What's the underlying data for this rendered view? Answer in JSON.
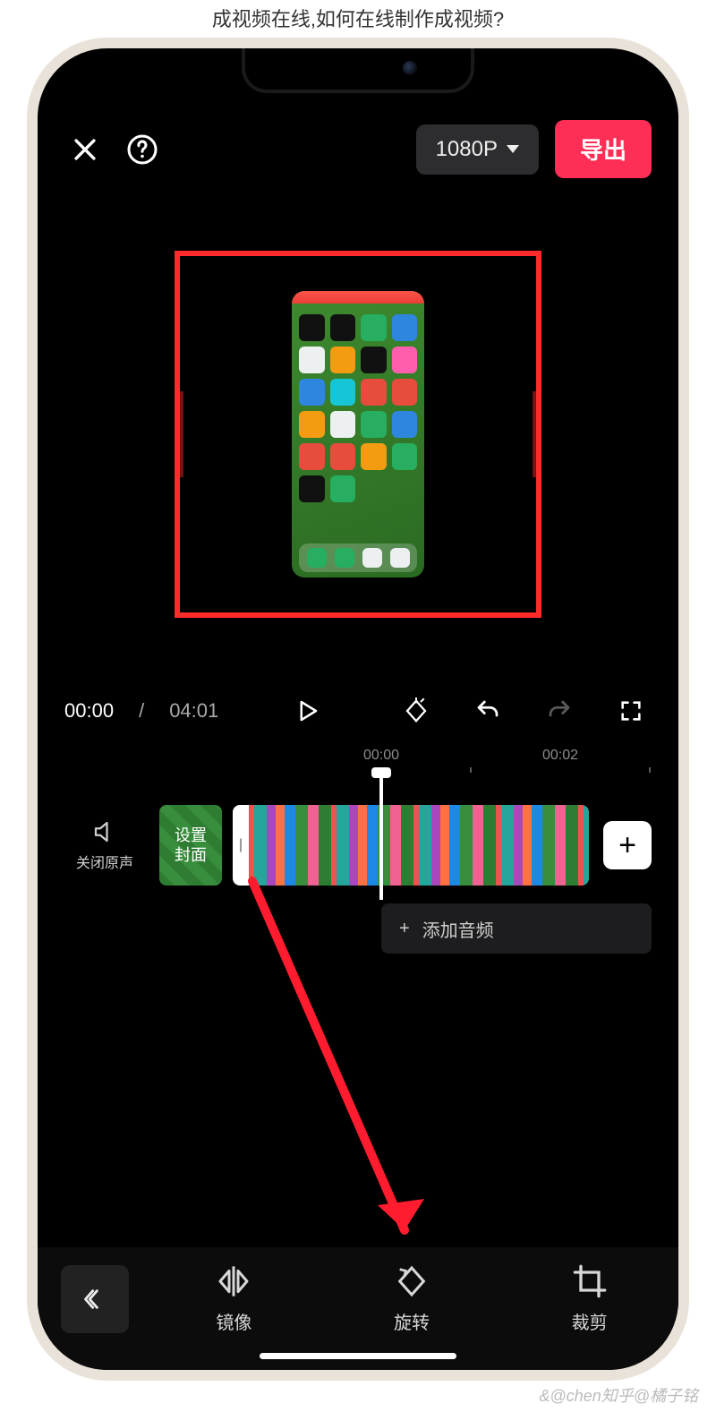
{
  "page": {
    "title": "成视频在线,如何在线制作成视频?",
    "watermark": "&@chen知乎@橘子铭"
  },
  "top": {
    "resolution": "1080P",
    "export_label": "导出"
  },
  "playback": {
    "current": "00:00",
    "separator": "/",
    "duration": "04:01",
    "ruler": [
      "00:00",
      "00:02"
    ]
  },
  "timeline": {
    "mute_label": "关闭原声",
    "cover_line1": "设置",
    "cover_line2": "封面",
    "add_audio_label": "添加音频"
  },
  "tools": {
    "mirror": "镜像",
    "rotate": "旋转",
    "crop": "裁剪"
  }
}
